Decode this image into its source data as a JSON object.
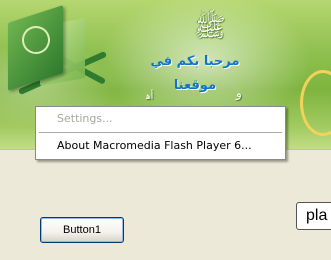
{
  "banner": {
    "calligraphy_text": "ﷺ",
    "welcome_text": "مرحبا بكم في موقعنا",
    "deco_text_1": "ﻭ",
    "deco_text_2": "ﺃﻫ"
  },
  "context_menu": {
    "items": [
      {
        "label": "Settings...",
        "enabled": false
      },
      {
        "label": "About Macromedia Flash Player 6...",
        "enabled": true
      }
    ]
  },
  "buttons": {
    "button1_label": "Button1",
    "play_label": "pla"
  },
  "colors": {
    "window_background": "#ECE9D8",
    "banner_green": "#8fc04f",
    "welcome_blue": "#1173c9",
    "disabled_text": "#a7a69e"
  }
}
